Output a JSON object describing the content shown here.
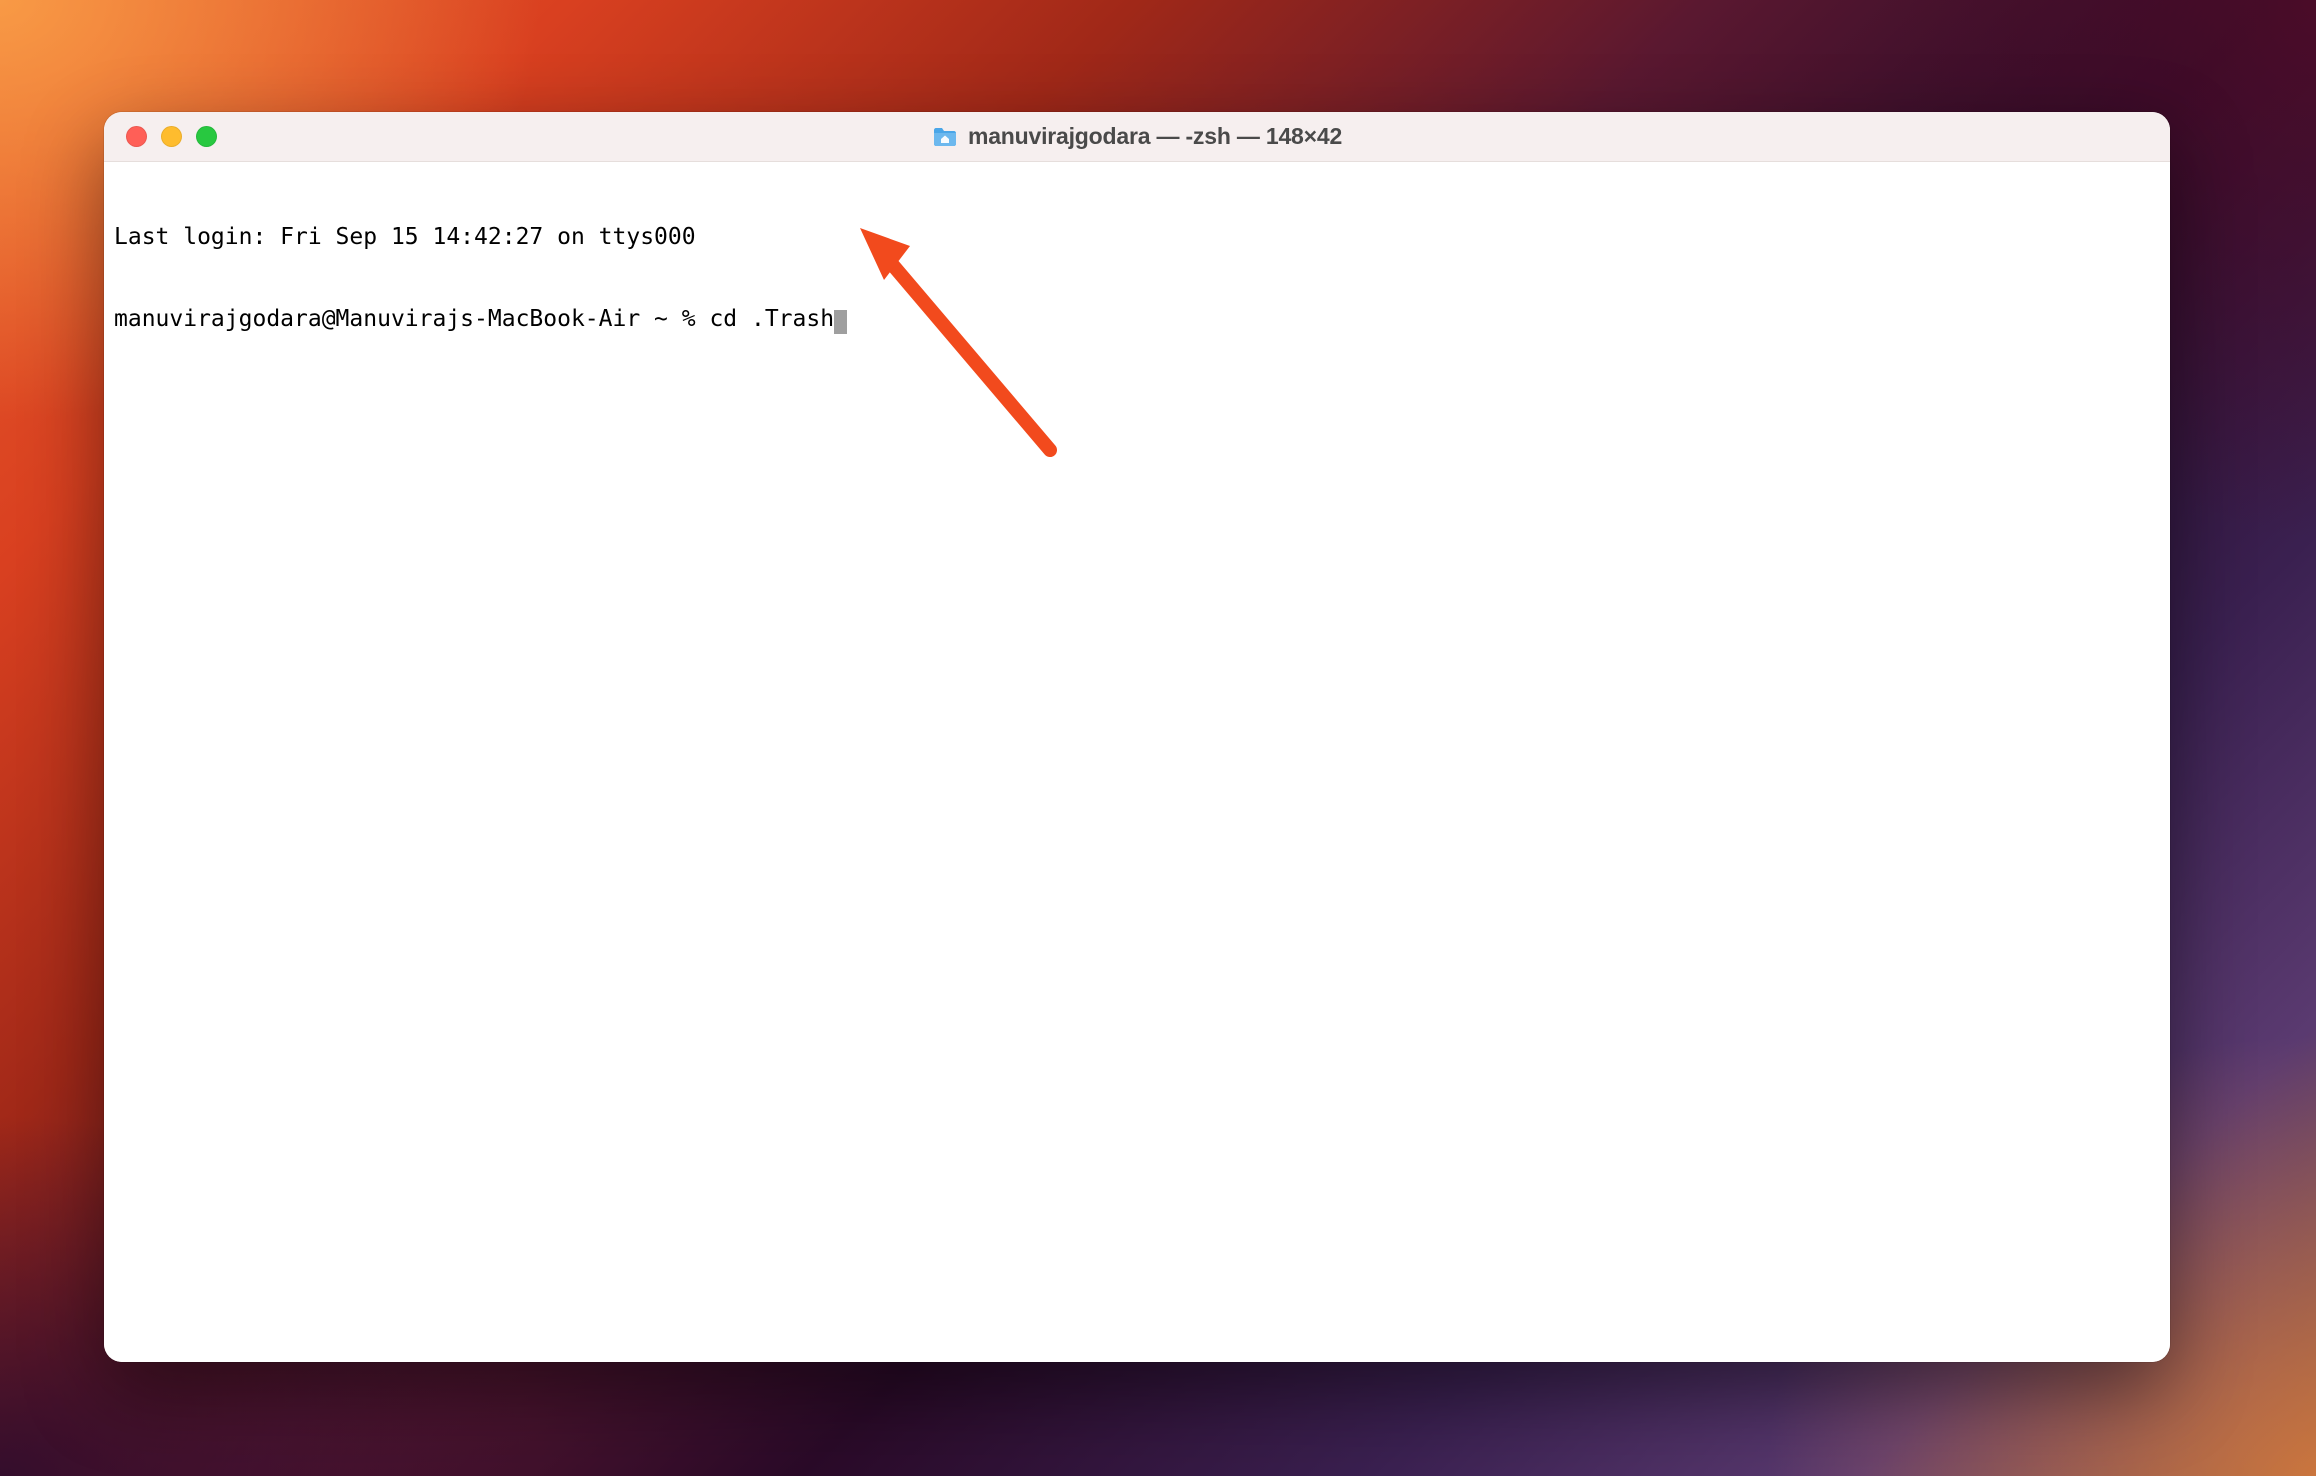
{
  "window": {
    "title": "manuvirajgodara — -zsh — 148×42",
    "folder_icon": "home-folder-icon"
  },
  "terminal": {
    "last_login_line": "Last login: Fri Sep 15 14:42:27 on ttys000",
    "prompt": "manuvirajgodara@Manuvirajs-MacBook-Air ~ % ",
    "command": "cd .Trash"
  },
  "traffic_lights": {
    "close": "close",
    "minimize": "minimize",
    "maximize": "maximize"
  }
}
